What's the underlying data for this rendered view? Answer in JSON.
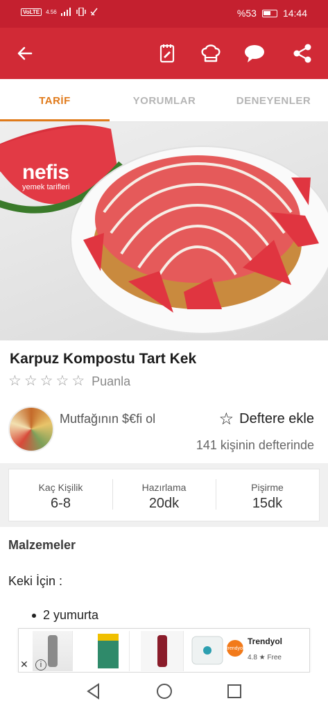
{
  "status_bar": {
    "network": "VoLTE",
    "speed": "4.56",
    "battery": "%53",
    "time": "14:44"
  },
  "app_bar": {
    "icons": [
      "back-arrow-icon",
      "notebook-icon",
      "chef-hat-icon",
      "comment-icon",
      "share-icon"
    ]
  },
  "tabs": [
    {
      "label": "TARİF",
      "active": true
    },
    {
      "label": "YORUMLAR",
      "active": false
    },
    {
      "label": "DENEYENLER",
      "active": false
    }
  ],
  "hero": {
    "logo_main": "nefis",
    "logo_sub": "yemek tarifleri"
  },
  "recipe": {
    "title": "Karpuz Kompostu Tart Kek",
    "rating_label": "Puanla",
    "author": "Mutfağının $€fi ol",
    "add_notebook": "Deftere ekle",
    "notebook_count": "141 kişinin defterinde"
  },
  "info": {
    "servings_label": "Kaç Kişilik",
    "servings_value": "6-8",
    "prep_label": "Hazırlama",
    "prep_value": "20dk",
    "cook_label": "Pişirme",
    "cook_value": "15dk"
  },
  "ingredients": {
    "title": "Malzemeler",
    "section": "Keki İçin :",
    "items": [
      "2 yumurta"
    ]
  },
  "ad": {
    "brand": "Trendyol",
    "rating_text": "4.8 ★  Free",
    "logo_text": "trendyol"
  },
  "colors": {
    "primary": "#d12a36",
    "status": "#c4202f",
    "accent": "#e07a1a"
  }
}
